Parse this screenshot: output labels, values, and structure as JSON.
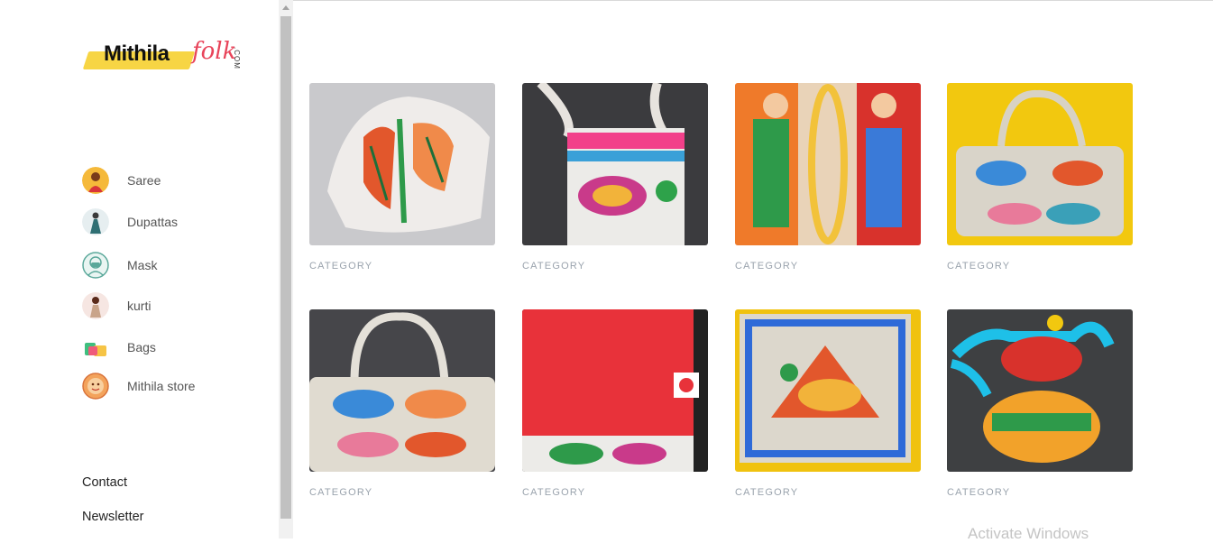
{
  "brand": {
    "logo_main": "Mithila",
    "logo_script": "folk",
    "logo_suffix": ".COM",
    "accent": "#e8445a",
    "brush": "#f7d544"
  },
  "sidebar": {
    "categories": [
      {
        "label": "Saree",
        "icon": "saree-avatar-icon"
      },
      {
        "label": "Dupattas",
        "icon": "dupatta-avatar-icon"
      },
      {
        "label": "Mask",
        "icon": "mask-avatar-icon"
      },
      {
        "label": "kurti",
        "icon": "kurti-avatar-icon"
      },
      {
        "label": "Bags",
        "icon": "bags-avatar-icon"
      },
      {
        "label": "Mithila store",
        "icon": "store-avatar-icon"
      }
    ],
    "footer_links": [
      {
        "label": "Contact"
      },
      {
        "label": "Newsletter"
      }
    ]
  },
  "products": [
    {
      "category": "CATEGORY",
      "image": "painted face mask"
    },
    {
      "category": "CATEGORY",
      "image": "painted sling bag"
    },
    {
      "category": "CATEGORY",
      "image": "Madhubani painting"
    },
    {
      "category": "CATEGORY",
      "image": "painted handbag on yellow"
    },
    {
      "category": "CATEGORY",
      "image": "painted handbag"
    },
    {
      "category": "CATEGORY",
      "image": "red painted folder"
    },
    {
      "category": "CATEGORY",
      "image": "painted square bag"
    },
    {
      "category": "CATEGORY",
      "image": "painted kettle"
    }
  ],
  "os_watermark": "Activate Windows"
}
